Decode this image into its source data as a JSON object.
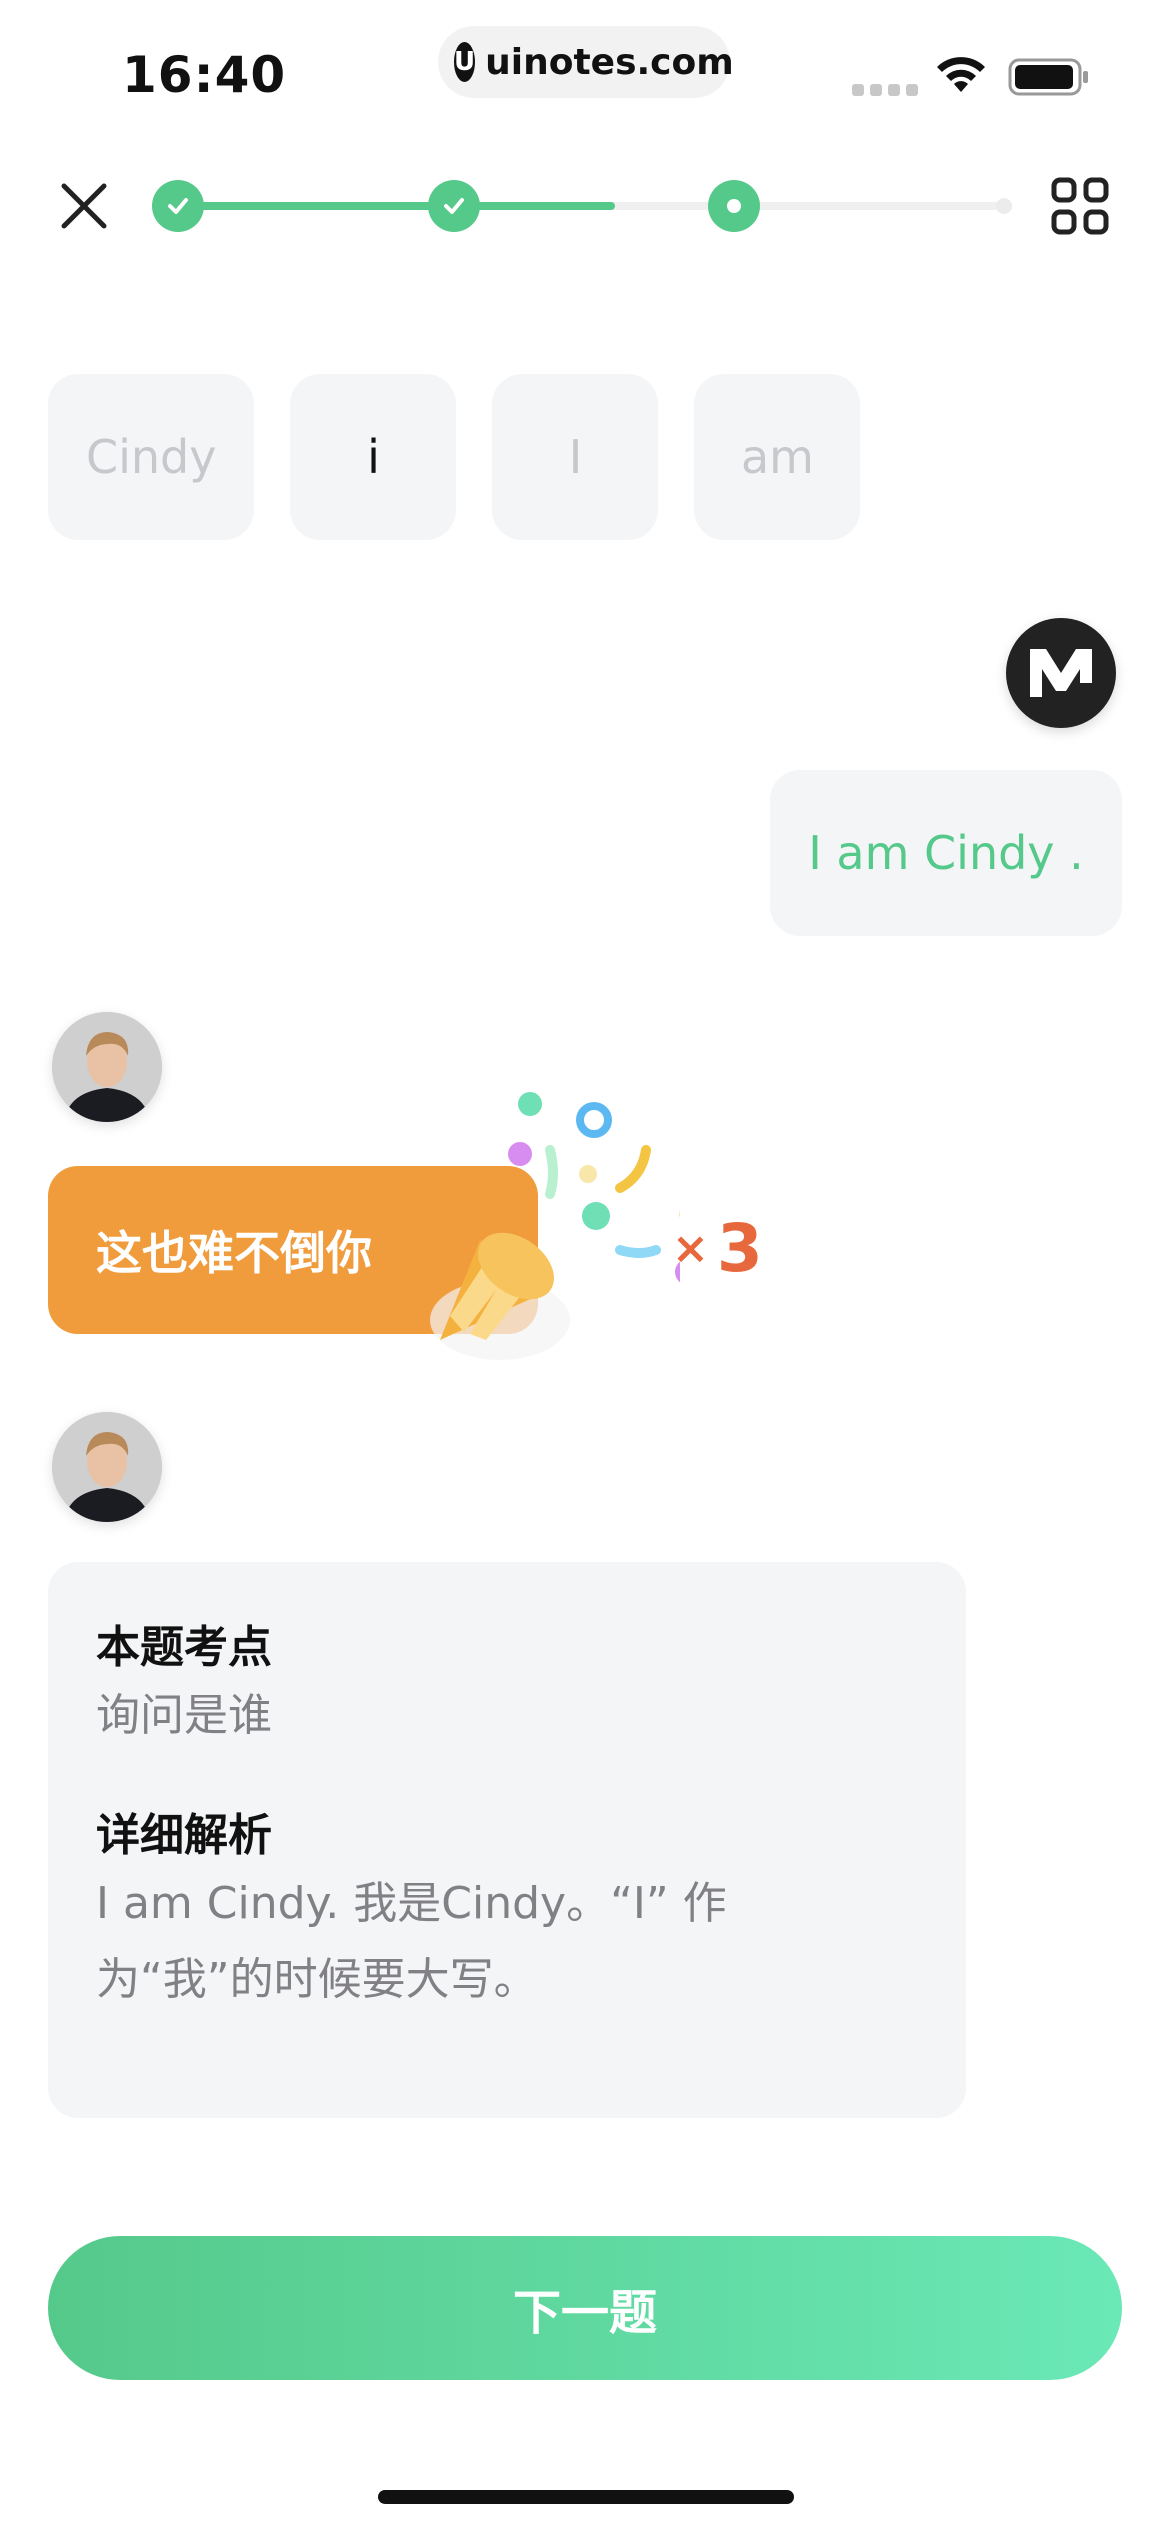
{
  "status_bar": {
    "time": "16:40",
    "url": "uinotes.com",
    "url_logo": "U"
  },
  "progress": {
    "completed_steps": 2,
    "current_step": 3,
    "fill_fraction": 0.53,
    "color": "#55c98a"
  },
  "word_tiles": [
    {
      "text": "Cindy",
      "state": "used"
    },
    {
      "text": "i",
      "state": "available"
    },
    {
      "text": "I",
      "state": "used"
    },
    {
      "text": "am",
      "state": "used"
    }
  ],
  "user_message": {
    "avatar_letter": "M",
    "text": "I am Cindy ."
  },
  "praise": {
    "text": "这也难不倒你",
    "combo_symbol": "×",
    "combo_count": "3",
    "color": "#f09b3c"
  },
  "explanation": {
    "point_heading": "本题考点",
    "point_text": "询问是谁",
    "detail_heading": "详细解析",
    "detail_text": "I am Cindy. 我是Cindy。“I” 作为“我”的时候要大写。"
  },
  "next_button": {
    "label": "下一题"
  },
  "icons": [
    "close-icon",
    "check-icon",
    "grid-icon",
    "wifi-icon",
    "battery-icon",
    "party-popper-icon"
  ]
}
